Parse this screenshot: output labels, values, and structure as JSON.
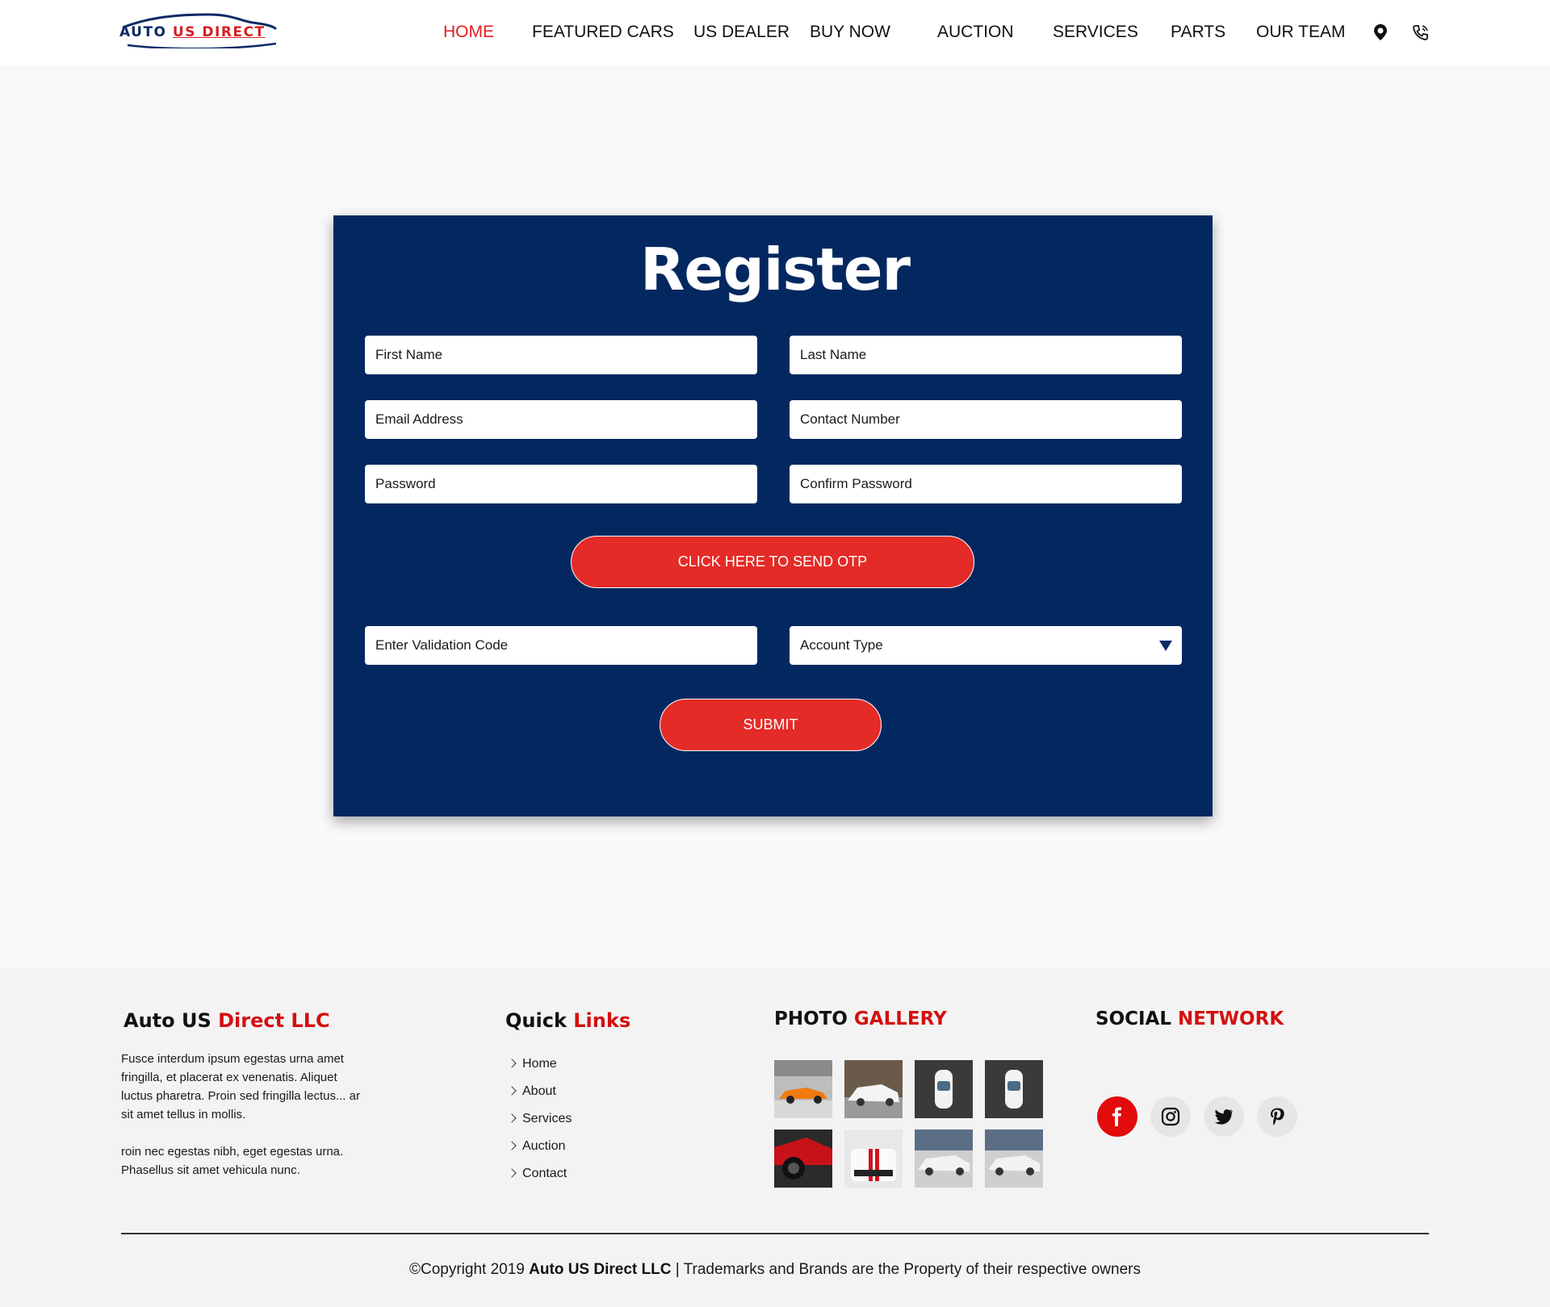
{
  "brand": {
    "logo_word_1": "AUTO",
    "logo_word_2": "US DIRECT"
  },
  "nav": {
    "items": [
      {
        "label": "HOME",
        "active": true
      },
      {
        "label": "FEATURED CARS"
      },
      {
        "label": "US DEALER"
      },
      {
        "label": "BUY NOW"
      },
      {
        "label": "AUCTION"
      },
      {
        "label": "SERVICES"
      },
      {
        "label": "PARTS"
      },
      {
        "label": "OUR TEAM"
      }
    ],
    "icons": [
      "location-pin-icon",
      "phone-icon"
    ]
  },
  "form": {
    "title": "Register",
    "first_name_placeholder": "First Name",
    "last_name_placeholder": "Last Name",
    "email_placeholder": "Email Address",
    "contact_placeholder": "Contact Number",
    "password_placeholder": "Password",
    "confirm_password_placeholder": "Confirm Password",
    "otp_button": "CLICK HERE TO SEND OTP",
    "validation_placeholder": "Enter Validation Code",
    "account_type_selected": "Account Type",
    "submit_button": "SUBMIT"
  },
  "footer": {
    "about": {
      "heading_black": "Auto US",
      "heading_red": "Direct LLC",
      "para_1": "Fusce interdum ipsum egestas urna amet fringilla, et placerat ex venenatis. Aliquet luctus pharetra. Proin sed fringilla lectus... ar sit amet tellus in mollis.",
      "para_2": "roin nec egestas nibh, eget egestas urna. Phasellus sit amet vehicula nunc."
    },
    "quick_links": {
      "heading_black": "Quick",
      "heading_red": "Links",
      "items": [
        "Home",
        "About",
        "Services",
        "Auction",
        "Contact"
      ]
    },
    "gallery": {
      "heading_black": "PHOTO",
      "heading_red": "GALLERY"
    },
    "social": {
      "heading_black": "SOCIAL",
      "heading_red": "NETWORK",
      "icons": [
        "facebook-icon",
        "instagram-icon",
        "twitter-icon",
        "pinterest-icon"
      ]
    },
    "copyright_prefix": "©Copyright 2019",
    "copyright_brand": "Auto US Direct LLC",
    "copyright_suffix": "| Trademarks and Brands are the Property of their respective owners"
  },
  "colors": {
    "accent_red": "#e42b27",
    "panel_navy": "#032860",
    "footer_bg": "#f3f3f3"
  }
}
